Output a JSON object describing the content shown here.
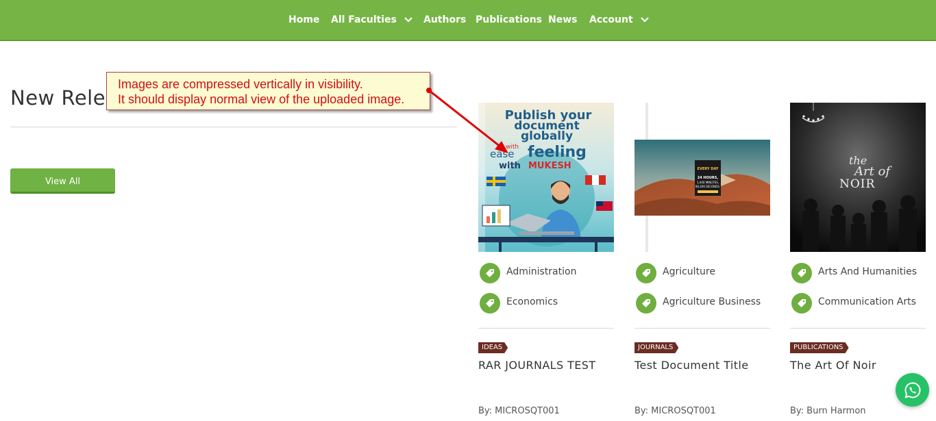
{
  "nav": {
    "items": [
      {
        "label": "Home"
      },
      {
        "label": "All Faculties",
        "dropdown": true
      },
      {
        "label": "Authors"
      },
      {
        "label": "Publications"
      },
      {
        "label": "News"
      },
      {
        "label": "Account",
        "dropdown": true
      }
    ]
  },
  "section": {
    "title": "New Releases",
    "view_all_label": "View All"
  },
  "annotation": {
    "line1": "Images are compressed vertically in visibility.",
    "line2": "It should display normal view of the uploaded image."
  },
  "cards": [
    {
      "cover_text": {
        "l1": "Publish your",
        "l2": "document",
        "l3": "globally",
        "l4a": "with",
        "l4b": "ease",
        "l4c": "feeling",
        "l5a": "with",
        "l5b": "MUKESH"
      },
      "tags": [
        "Administration",
        "Economics"
      ],
      "badge": "IDEAS",
      "title": "RAR JOURNALS TEST",
      "author": "By: MICROSQT001"
    },
    {
      "cover_text": {
        "l1": "EVERY DAY",
        "l2": "24 HOURS,",
        "l3": "1,440 MINUTES,",
        "l4": "86,400 SECONDS."
      },
      "tags": [
        "Agriculture",
        "Agriculture Business"
      ],
      "badge": "JOURNALS",
      "title": "Test Document Title",
      "author": "By: MICROSQT001"
    },
    {
      "cover_text": {
        "l1": "the",
        "l2": "Art of",
        "l3": "NOIR"
      },
      "tags": [
        "Arts And Humanities",
        "Communication Arts"
      ],
      "badge": "PUBLICATIONS",
      "title": "The Art Of Noir",
      "author": "By: Burn Harmon"
    }
  ],
  "colors": {
    "nav_bg": "#76b545",
    "button_bg": "#70b244",
    "badge_bg": "#6b2c22",
    "annotation_text": "#d01010",
    "whatsapp": "#27c167"
  },
  "icons": {
    "tag": "tag-icon",
    "chevron": "chevron-down-icon",
    "whatsapp": "whatsapp-icon"
  }
}
